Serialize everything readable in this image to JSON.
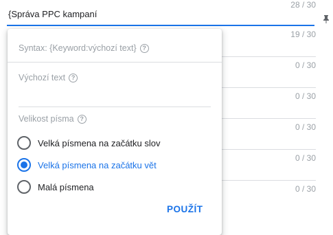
{
  "headline": {
    "text": "{Správa PPC kampaní",
    "counter": "28 / 30"
  },
  "rows": [
    {
      "counter": "19 / 30"
    },
    {
      "counter": "0 / 30"
    },
    {
      "counter": "0 / 30"
    },
    {
      "counter": "0 / 30"
    },
    {
      "counter": "0 / 30"
    },
    {
      "counter": "0 / 30"
    }
  ],
  "popup": {
    "syntax": "Syntax: {Keyword:výchozí text}",
    "default_text_label": "Výchozí text",
    "default_text_value": "",
    "case_label": "Velikost písma",
    "options": [
      {
        "label": "Velká písmena na začátku slov",
        "selected": false
      },
      {
        "label": "Velká písmena na začátku vět",
        "selected": true
      },
      {
        "label": "Malá písmena",
        "selected": false
      }
    ],
    "apply_label": "POUŽÍT"
  },
  "colors": {
    "accent": "#1a73e8",
    "muted_text": "#9aa0a6",
    "divider": "#dadce0"
  }
}
